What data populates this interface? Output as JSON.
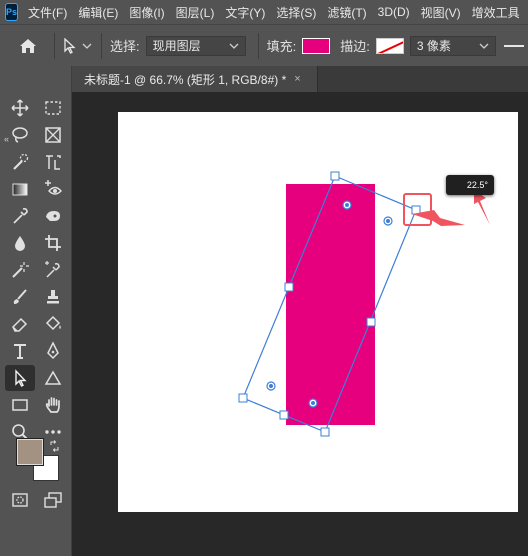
{
  "menubar": {
    "logo": "Ps",
    "items": [
      "文件(F)",
      "编辑(E)",
      "图像(I)",
      "图层(L)",
      "文字(Y)",
      "选择(S)",
      "滤镜(T)",
      "3D(D)",
      "视图(V)",
      "增效工具"
    ]
  },
  "options": {
    "select_label": "选择:",
    "select_value": "现用图层",
    "fill_label": "填充:",
    "stroke_label": "描边:",
    "stroke_width": "3 像素",
    "fill_color": "#e6007e"
  },
  "document_tab": {
    "title": "未标题-1 @ 66.7% (矩形 1, RGB/8#) *",
    "close": "×"
  },
  "toolbar": {
    "collapse": "«",
    "foreground_color": "#a39282",
    "background_color": "#ffffff"
  },
  "canvas": {
    "shape_color": "#e6007e",
    "rotation_readout": "22.5°"
  }
}
